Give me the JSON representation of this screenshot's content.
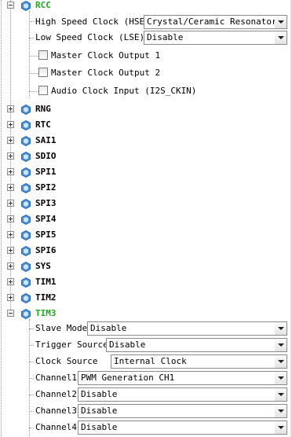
{
  "rcc": {
    "label": "RCC",
    "hse_label": "High Speed Clock (HSE)",
    "hse_value": "Crystal/Ceramic Resonator",
    "lse_label": "Low Speed Clock (LSE)",
    "lse_value": "Disable",
    "mco1_label": "Master Clock Output 1",
    "mco2_label": "Master Clock Output 2",
    "audio_label": "Audio Clock Input (I2S_CKIN)"
  },
  "tree": {
    "rng": "RNG",
    "rtc": "RTC",
    "sai1": "SAI1",
    "sdio": "SDIO",
    "spi1": "SPI1",
    "spi2": "SPI2",
    "spi3": "SPI3",
    "spi4": "SPI4",
    "spi5": "SPI5",
    "spi6": "SPI6",
    "sys": "SYS",
    "tim1": "TIM1",
    "tim2": "TIM2"
  },
  "tim3": {
    "label": "TIM3",
    "slave_mode_label": "Slave Mode",
    "slave_mode_value": "Disable",
    "trigger_label": "Trigger Source",
    "trigger_value": "Disable",
    "clock_label": "Clock Source",
    "clock_value": "Internal Clock",
    "ch1_label": "Channel1",
    "ch1_value": "PWM Generation CH1",
    "ch2_label": "Channel2",
    "ch2_value": "Disable",
    "ch3_label": "Channel3",
    "ch3_value": "Disable",
    "ch4_label": "Channel4",
    "ch4_value": "Disable"
  },
  "icons": {
    "node": "peripheral-hex-icon",
    "expand": "plus-expander",
    "collapse": "minus-expander"
  },
  "colors": {
    "active_label": "#1fa81f",
    "icon_blue": "#4a8fd6"
  }
}
